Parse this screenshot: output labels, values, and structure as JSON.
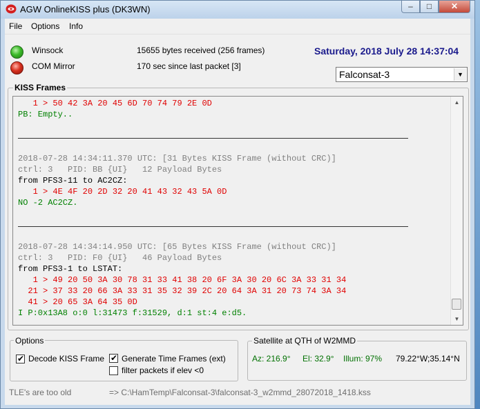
{
  "window": {
    "title": "AGW OnlineKISS plus (DK3WN)",
    "controls": {
      "minimize": "–",
      "maximize": "□",
      "close": "✕"
    }
  },
  "menu": [
    {
      "label": "File"
    },
    {
      "label": "Options"
    },
    {
      "label": "Info"
    }
  ],
  "status": {
    "winsock": {
      "label": "Winsock",
      "info": "15655 bytes received (256 frames)",
      "led": "#3cba2a"
    },
    "com": {
      "label": "COM Mirror",
      "info": "170 sec since last packet [3]",
      "led": "#d8301f"
    },
    "datetime": "Saturday, 2018 July 28  14:37:04",
    "satellite_select": "Falconsat-3"
  },
  "kiss": {
    "title": "KISS Frames",
    "lines": [
      {
        "text": "   1 > 50 42 3A 20 45 6D 70 74 79 2E 0D",
        "color": "#e00000"
      },
      {
        "text": "PB: Empty..",
        "color": "#008000"
      },
      {
        "text": "",
        "color": "#000000"
      },
      {
        "text": "",
        "color": "#000000",
        "sep": true
      },
      {
        "text": "",
        "color": "#000000"
      },
      {
        "text": "2018-07-28 14:34:11.370 UTC: [31 Bytes KISS Frame (without CRC)]",
        "color": "#808080"
      },
      {
        "text": "ctrl: 3   PID: BB {UI}   12 Payload Bytes",
        "color": "#808080"
      },
      {
        "text": "from PFS3-11 to AC2CZ:",
        "color": "#000000"
      },
      {
        "text": "   1 > 4E 4F 20 2D 32 20 41 43 32 43 5A 0D",
        "color": "#e00000"
      },
      {
        "text": "NO -2 AC2CZ.",
        "color": "#008000"
      },
      {
        "text": "",
        "color": "#000000"
      },
      {
        "text": "",
        "color": "#000000",
        "sep": true
      },
      {
        "text": "",
        "color": "#000000"
      },
      {
        "text": "2018-07-28 14:34:14.950 UTC: [65 Bytes KISS Frame (without CRC)]",
        "color": "#808080"
      },
      {
        "text": "ctrl: 3   PID: F0 {UI}   46 Payload Bytes",
        "color": "#808080"
      },
      {
        "text": "from PFS3-1 to LSTAT:",
        "color": "#000000"
      },
      {
        "text": "   1 > 49 20 50 3A 30 78 31 33 41 38 20 6F 3A 30 20 6C 3A 33 31 34",
        "color": "#e00000"
      },
      {
        "text": "  21 > 37 33 20 66 3A 33 31 35 32 39 2C 20 64 3A 31 20 73 74 3A 34",
        "color": "#e00000"
      },
      {
        "text": "  41 > 20 65 3A 64 35 0D",
        "color": "#e00000"
      },
      {
        "text": "I P:0x13A8 o:0 l:31473 f:31529, d:1 st:4 e:d5.",
        "color": "#008000"
      },
      {
        "text": "",
        "color": "#000000"
      },
      {
        "text": "",
        "color": "#000000",
        "sep": true
      }
    ]
  },
  "options": {
    "title": "Options",
    "decode_kiss": {
      "label": "Decode KISS Frame",
      "checked": true
    },
    "generate_time": {
      "label": "Generate Time Frames (ext)",
      "checked": true
    },
    "filter_packets": {
      "label": "filter packets if elev <0",
      "checked": false
    }
  },
  "satellite": {
    "title": "Satellite at QTH of W2MMD",
    "az": "Az: 216.9°",
    "el": "El: 32.9°",
    "illum": "Illum: 97%",
    "coords": "79.22°W;35.14°N",
    "value_color": "#007000"
  },
  "footer": {
    "tle_status": "TLE's are too old",
    "log_path": "=> C:\\HamTemp\\Falconsat-3\\falconsat-3_w2mmd_28072018_1418.kss"
  }
}
